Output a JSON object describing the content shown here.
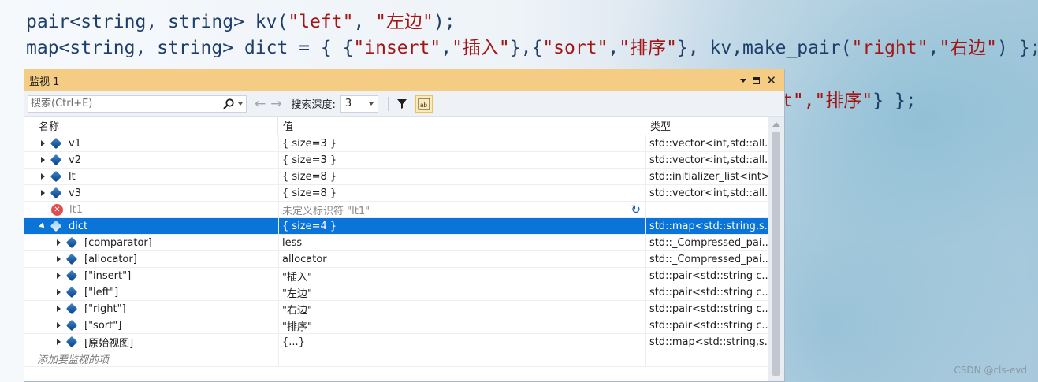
{
  "code": {
    "line1": {
      "p1": "pair<string, string> kv(",
      "s1": "\"left\"",
      "p2": ", ",
      "s2": "\"左边\"",
      "p3": ");"
    },
    "line2": {
      "p1": "map<string, string> dict = { {",
      "s1": "\"insert\"",
      "p2": ",",
      "s2": "\"插入\"",
      "p3": "},{",
      "s3": "\"sort\"",
      "p4": ",",
      "s4": "\"排序\"",
      "p5": "}, kv,make_pair(",
      "s5": "\"right\"",
      "p6": ",",
      "s6": "\"右边\"",
      "p7": ") };"
    },
    "line3": {
      "s1": "t\",\"排序\"",
      "p1": "} };"
    }
  },
  "watch": {
    "title": "监视 1",
    "search_placeholder": "搜索(Ctrl+E)",
    "depth_label": "搜索深度:",
    "depth_value": "3",
    "columns": {
      "name": "名称",
      "value": "值",
      "type": "类型"
    },
    "rows": [
      {
        "name": "v1",
        "value": "{ size=3 }",
        "type": "std::vector<int,std::all..."
      },
      {
        "name": "v2",
        "value": "{ size=3 }",
        "type": "std::vector<int,std::all..."
      },
      {
        "name": "lt",
        "value": "{ size=8 }",
        "type": "std::initializer_list<int>"
      },
      {
        "name": "v3",
        "value": "{ size=8 }",
        "type": "std::vector<int,std::all..."
      },
      {
        "name": "lt1",
        "value": "未定义标识符 \"lt1\"",
        "type": ""
      },
      {
        "name": "dict",
        "value": "{ size=4 }",
        "type": "std::map<std::string,s..."
      },
      {
        "name": "[comparator]",
        "value": "less",
        "type": "std::_Compressed_pai..."
      },
      {
        "name": "[allocator]",
        "value": "allocator",
        "type": "std::_Compressed_pai..."
      },
      {
        "name": "[\"insert\"]",
        "value": "\"插入\"",
        "type": "std::pair<std::string c..."
      },
      {
        "name": "[\"left\"]",
        "value": "\"左边\"",
        "type": "std::pair<std::string c..."
      },
      {
        "name": "[\"right\"]",
        "value": "\"右边\"",
        "type": "std::pair<std::string c..."
      },
      {
        "name": "[\"sort\"]",
        "value": "\"排序\"",
        "type": "std::pair<std::string c..."
      },
      {
        "name": "[原始视图]",
        "value": "{...}",
        "type": "std::map<std::string,s..."
      }
    ],
    "add_item": "添加要监视的项"
  },
  "watermark": "CSDN @cls-evd",
  "colors": {
    "accent": "#f5cc84",
    "selection": "#0a74d9",
    "string": "#a31515"
  }
}
